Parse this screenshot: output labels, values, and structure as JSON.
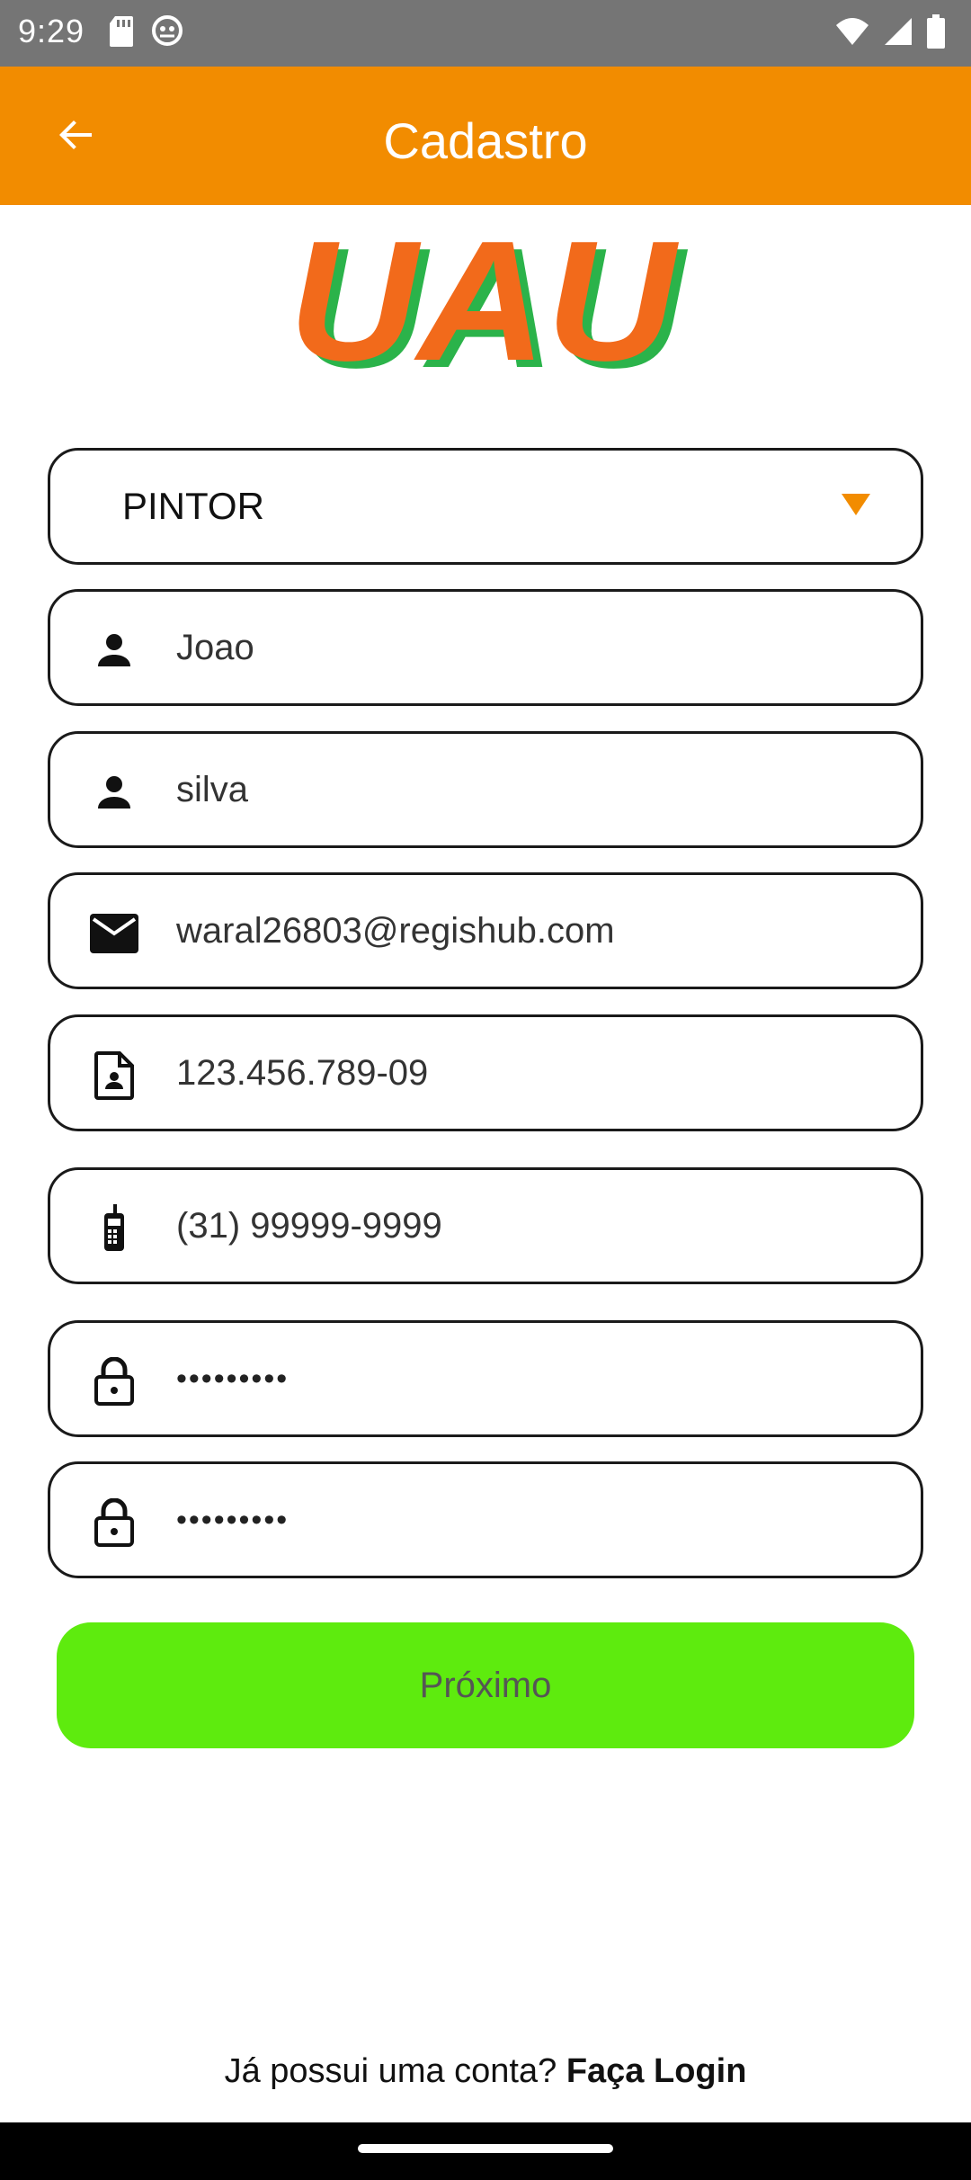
{
  "status_bar": {
    "time": "9:29"
  },
  "app_bar": {
    "title": "Cadastro"
  },
  "logo": {
    "text": "UAU",
    "colors": {
      "fill": "#f26a1b",
      "shadow": "#2bb34a"
    }
  },
  "form": {
    "profession_select": {
      "selected": "PINTOR"
    },
    "first_name": {
      "value": "Joao",
      "icon": "person-icon"
    },
    "last_name": {
      "value": "silva",
      "icon": "person-icon"
    },
    "email": {
      "value": "waral26803@regishub.com",
      "icon": "mail-icon"
    },
    "cpf": {
      "value": "123.456.789-09",
      "icon": "document-icon"
    },
    "phone": {
      "value": "(31) 99999-9999",
      "icon": "phone-icon"
    },
    "password": {
      "value": "•••••••••",
      "icon": "lock-icon"
    },
    "confirm_password": {
      "value": "•••••••••",
      "icon": "lock-icon"
    },
    "next_button": "Próximo"
  },
  "footer": {
    "prompt": "Já possui uma conta? ",
    "login_link": "Faça Login"
  },
  "colors": {
    "accent": "#f28c00",
    "button": "#5eeb0e"
  }
}
